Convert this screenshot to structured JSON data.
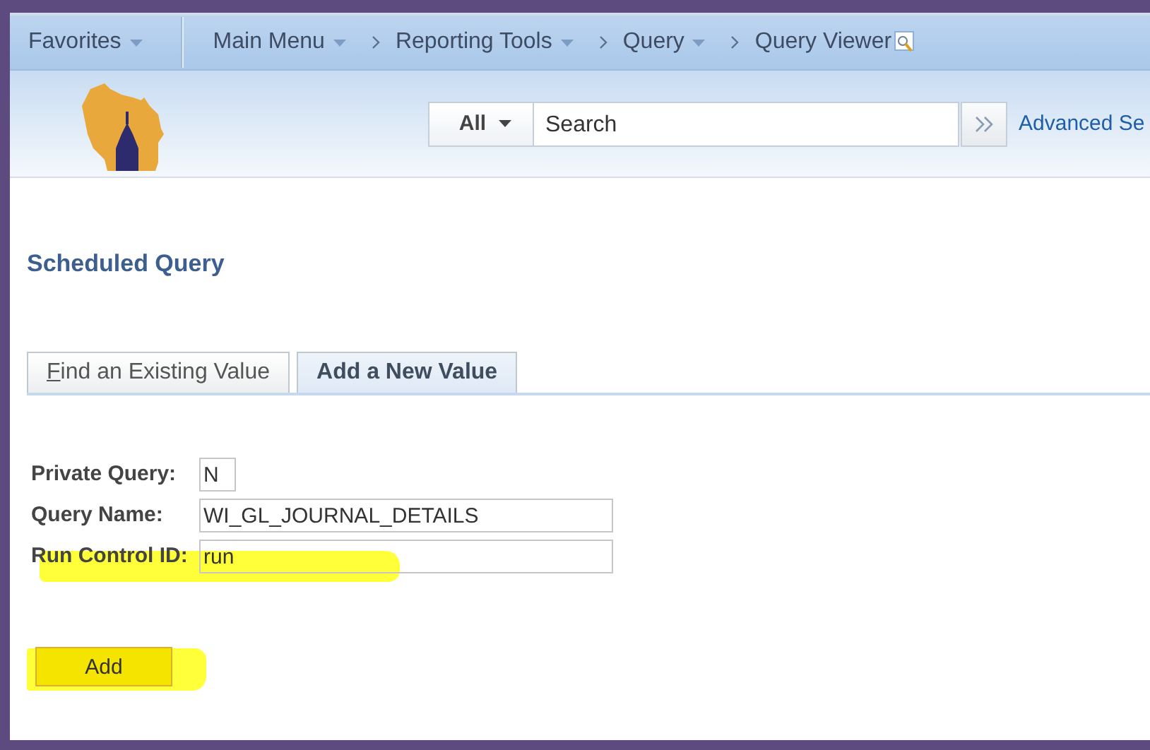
{
  "nav": {
    "favorites": "Favorites",
    "breadcrumbs": [
      {
        "label": "Main Menu",
        "dropdown": true
      },
      {
        "label": "Reporting Tools",
        "dropdown": true
      },
      {
        "label": "Query",
        "dropdown": true
      },
      {
        "label": "Query Viewer",
        "dropdown": false
      }
    ]
  },
  "search": {
    "scope": "All",
    "placeholder": "Search",
    "advanced_link": "Advanced Se"
  },
  "page_title": "Scheduled Query",
  "tabs": [
    {
      "label": "Find an Existing Value",
      "selected": false,
      "accesskey_underlined": true
    },
    {
      "label": "Add a New Value",
      "selected": true,
      "accesskey_underlined": false
    }
  ],
  "form": [
    {
      "label": "Private Query:",
      "value": "N",
      "highlighted": false
    },
    {
      "label": "Query Name:",
      "value": "WI_GL_JOURNAL_DETAILS",
      "highlighted": false
    },
    {
      "label": "Run Control ID:",
      "value": "run",
      "highlighted": true
    }
  ],
  "add_button": {
    "label": "Add",
    "highlighted": true
  }
}
